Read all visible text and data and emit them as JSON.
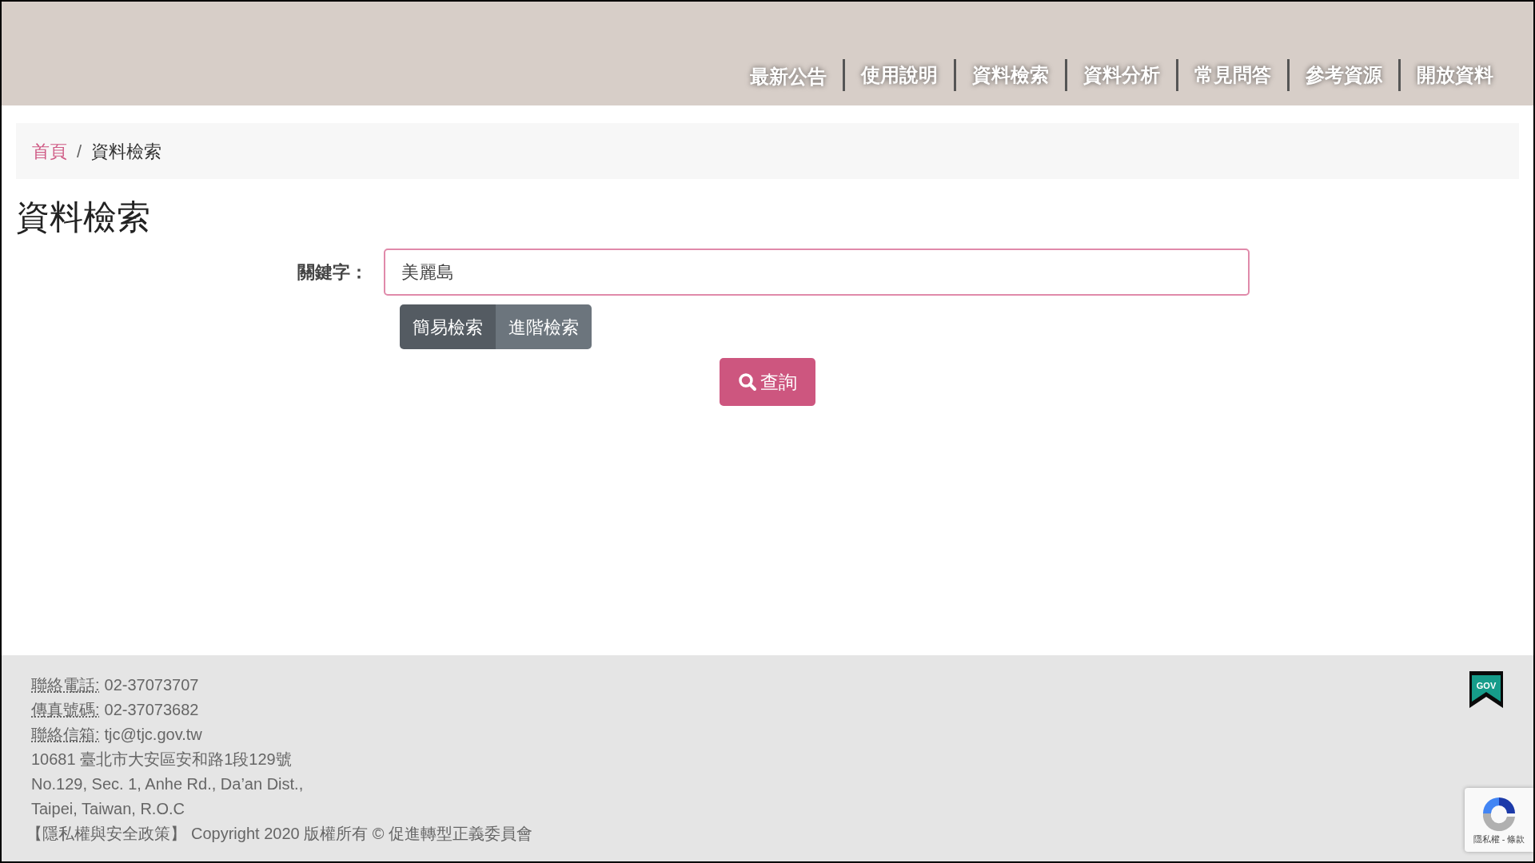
{
  "nav": [
    {
      "label": "最新公告"
    },
    {
      "label": "使用說明"
    },
    {
      "label": "資料檢索"
    },
    {
      "label": "資料分析"
    },
    {
      "label": "常見問答"
    },
    {
      "label": "參考資源"
    },
    {
      "label": "開放資料"
    }
  ],
  "breadcrumb": [
    {
      "label": "首頁",
      "kind": "link"
    },
    {
      "label": "資料檢索",
      "kind": "current"
    }
  ],
  "breadcrumb_separator": "/",
  "page_title": "資料檢索",
  "search": {
    "label": "關鍵字：",
    "value": "美麗島"
  },
  "modes": [
    {
      "label": "簡易檢索",
      "selected": true
    },
    {
      "label": "進階檢索",
      "selected": false
    }
  ],
  "submit": "查詢",
  "footer": {
    "contacts": [
      {
        "label": "聯絡電話:",
        "value": "02-37073707"
      },
      {
        "label": "傳真號碼:",
        "value": "02-37073682"
      },
      {
        "label": "聯絡信箱:",
        "value": "tjc@tjc.gov.tw"
      }
    ],
    "address": [
      "10681 臺北市大安區安和路1段129號",
      "No.129, Sec. 1, Anhe Rd., Da’an Dist.,",
      "Taipei, Taiwan, R.O.C"
    ],
    "privacy_link": "【隱私權與安全政策】",
    "copyright": "Copyright 2020 版權所有 © 促進轉型正義委員會",
    "gov_badge": "GOV"
  },
  "recaptcha": "隱私權 - 條款"
}
